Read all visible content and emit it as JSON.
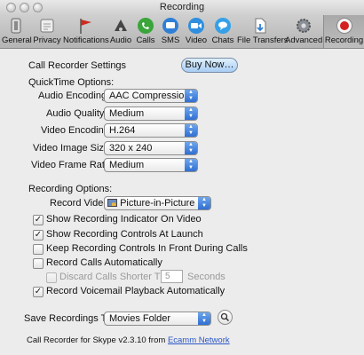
{
  "window": {
    "title": "Recording"
  },
  "toolbar": {
    "items": [
      {
        "label": "General",
        "icon": "general-icon"
      },
      {
        "label": "Privacy",
        "icon": "privacy-icon"
      },
      {
        "label": "Notifications",
        "icon": "notifications-flag-icon"
      },
      {
        "label": "Audio",
        "icon": "audio-icon"
      },
      {
        "label": "Calls",
        "icon": "calls-icon"
      },
      {
        "label": "SMS",
        "icon": "sms-icon"
      },
      {
        "label": "Video",
        "icon": "video-icon"
      },
      {
        "label": "Chats",
        "icon": "chats-icon"
      },
      {
        "label": "File Transfers",
        "icon": "file-transfers-icon"
      },
      {
        "label": "Advanced",
        "icon": "advanced-gear-icon"
      },
      {
        "label": "Recording",
        "icon": "recording-icon"
      }
    ],
    "selected": "Recording"
  },
  "settings": {
    "header": "Call Recorder Settings",
    "buy_label": "Buy Now…",
    "quicktime": {
      "section": "QuickTime Options:",
      "audio_encoding": {
        "label": "Audio Encoding:",
        "value": "AAC Compression"
      },
      "audio_quality": {
        "label": "Audio Quality:",
        "value": "Medium"
      },
      "video_encoding": {
        "label": "Video Encoding:",
        "value": "H.264"
      },
      "video_image_size": {
        "label": "Video Image Size:",
        "value": "320 x 240"
      },
      "video_frame_rate": {
        "label": "Video Frame Rate:",
        "value": "Medium"
      }
    },
    "recording": {
      "section": "Recording Options:",
      "record_video": {
        "label": "Record Video:",
        "value": "Picture-in-Picture"
      },
      "checks": {
        "show_indicator": {
          "label": "Show Recording Indicator On Video",
          "checked": true
        },
        "show_controls": {
          "label": "Show Recording Controls At Launch",
          "checked": true
        },
        "keep_front": {
          "label": "Keep Recording Controls In Front During Calls",
          "checked": false
        },
        "record_auto": {
          "label": "Record Calls Automatically",
          "checked": false
        },
        "discard_short": {
          "label": "Discard Calls Shorter Than",
          "checked": false,
          "value": "5",
          "units": "Seconds"
        },
        "voicemail": {
          "label": "Record Voicemail Playback Automatically",
          "checked": true
        }
      }
    },
    "save": {
      "label": "Save Recordings To:",
      "value": "Movies Folder"
    },
    "footer": {
      "text": "Call Recorder for Skype v2.3.10 from ",
      "link": "Ecamm Network"
    }
  },
  "colors": {
    "accent": "#2f6fd2",
    "link": "#2a56c6",
    "record": "#d42020"
  }
}
